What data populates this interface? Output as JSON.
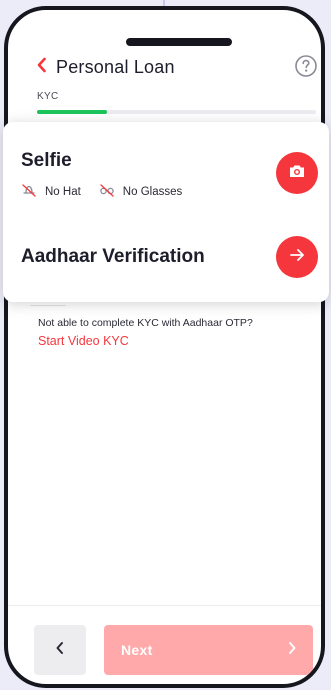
{
  "header": {
    "back_icon": "chevron-left-icon",
    "title": "Personal Loan",
    "help_icon": "question-circle-icon"
  },
  "progress": {
    "step_label": "KYC",
    "fraction": 0.25,
    "fill_color": "#1cc45a"
  },
  "kyc_card": {
    "selfie": {
      "title": "Selfie",
      "tips": [
        {
          "icon": "no-hat-icon",
          "label": "No Hat"
        },
        {
          "icon": "no-glasses-icon",
          "label": "No Glasses"
        }
      ],
      "action_icon": "camera-icon"
    },
    "aadhaar": {
      "title": "Aadhaar Verification",
      "action_icon": "arrow-right-icon"
    }
  },
  "video_kyc": {
    "note": "Not able to complete KYC with Aadhaar OTP?",
    "link": "Start Video KYC"
  },
  "footer": {
    "prev_icon": "chevron-left-icon",
    "next_label": "Next",
    "next_icon": "chevron-right-icon"
  },
  "colors": {
    "accent": "#f5373d",
    "next_disabled": "#ffa9aa",
    "progress": "#1cc45a"
  }
}
